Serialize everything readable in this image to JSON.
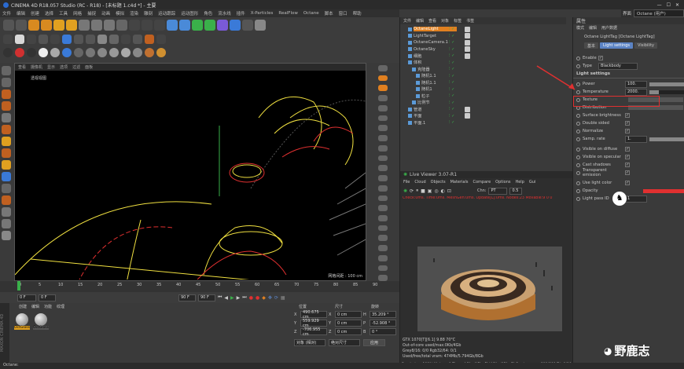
{
  "title_bar": {
    "text": "CINEMA 4D R18.057 Studio (RC - R18) - [未标题 1.c4d *] - 主要"
  },
  "menu": {
    "items": [
      "文件",
      "编辑",
      "创建",
      "选择",
      "工具",
      "网格",
      "捕捉",
      "动画",
      "模拟",
      "渲染",
      "雕刻",
      "运动跟踪",
      "运动图形",
      "角色",
      "流水线",
      "插件",
      "X-Particles",
      "RealFlow",
      "Octane",
      "脚本",
      "窗口",
      "帮助"
    ]
  },
  "layout": {
    "label": "界面",
    "value": "Octane (用户)"
  },
  "viewport": {
    "menu": [
      "查看",
      "摄像机",
      "显示",
      "选项",
      "过滤",
      "面板"
    ],
    "camera_label": "透视视图",
    "grid_text": "网格间距 : 100 cm"
  },
  "timeline": {
    "ticks": [
      "0",
      "5",
      "10",
      "15",
      "20",
      "25",
      "30",
      "35",
      "40",
      "45",
      "50",
      "55",
      "60",
      "65",
      "70",
      "75",
      "80",
      "85",
      "90"
    ],
    "current": "0 F",
    "start": "0 F",
    "end": "90 F",
    "end2": "90 F",
    "frame_badge": "0 F"
  },
  "materials": {
    "menu": [
      "创建",
      "编辑",
      "功能",
      "纹理"
    ],
    "items": [
      "OctGloss",
      "OctGloss"
    ]
  },
  "coords": {
    "headers": [
      "位置",
      "尺寸",
      "旋转"
    ],
    "rows": [
      [
        "X",
        "490.675 cm",
        "X",
        "0 cm",
        "H",
        "35.209 °"
      ],
      [
        "Y",
        "559.929 cm",
        "Y",
        "0 cm",
        "P",
        "-52.908 °"
      ],
      [
        "Z",
        "-706.955 cm",
        "Z",
        "0 cm",
        "B",
        "0 °"
      ]
    ],
    "mode1": "对象 (相对)",
    "mode2": "绝对尺寸",
    "apply": "应用"
  },
  "object_manager": {
    "menu": [
      "文件",
      "编辑",
      "查看",
      "对象",
      "标签",
      "书签"
    ],
    "objects": [
      {
        "name": "OctaneLight",
        "indent": 0,
        "selected": true
      },
      {
        "name": "LightTarget",
        "indent": 0,
        "selected": false
      },
      {
        "name": "OctaneCamera.1",
        "indent": 0,
        "selected": false
      },
      {
        "name": "OctaneSky",
        "indent": 0,
        "selected": false
      },
      {
        "name": "细胞",
        "indent": 0,
        "selected": false
      },
      {
        "name": "体积",
        "indent": 0,
        "selected": false
      },
      {
        "name": "克隆器",
        "indent": 1,
        "selected": false
      },
      {
        "name": "随机1.1",
        "indent": 2,
        "selected": false
      },
      {
        "name": "随机1.1",
        "indent": 2,
        "selected": false
      },
      {
        "name": "随机1",
        "indent": 2,
        "selected": false
      },
      {
        "name": "粒子",
        "indent": 2,
        "selected": false
      },
      {
        "name": "比例节",
        "indent": 1,
        "selected": false
      },
      {
        "name": "管道",
        "indent": 0,
        "selected": false
      },
      {
        "name": "平面",
        "indent": 0,
        "selected": false
      },
      {
        "name": "平面.1",
        "indent": 0,
        "selected": false
      }
    ]
  },
  "live_viewer": {
    "title": "Live Viewer 3.07-R1",
    "menu": [
      "File",
      "Cloud",
      "Objects",
      "Materials",
      "Compare",
      "Options",
      "Help",
      "Gui"
    ],
    "channel_label": "Chn:",
    "channel_value": "PT",
    "zoom": "0.5",
    "status_line": "Check:0ms. Time:0ms. MeshGen:0ms. Update[L]:0ms. Nodes:23 Movable:9  0 0",
    "stats": [
      "GTX 1070[T][6.1]   9.88   70°C",
      "Out-of-core used/max:0Kb/4Gb",
      "Grey8/16: 0/0          Rgb32/64: 0/1",
      "Used/free/total vram: 474Mb/5.794Gb/8Gb"
    ],
    "render_line": "Rendering: 100%   Ms/sec: 0   Time: 小时 : 分钟 : 秒/小时 : 分钟 : 秒   Spp/maxspp: 800/800   Tri: 0/196k   Mesh: 1/32"
  },
  "attributes": {
    "top_label": "属性",
    "menu": [
      "模式",
      "编辑",
      "用户数据"
    ],
    "object_title": "Octane LightTag [Octane LightTag]",
    "tabs": [
      "基本",
      "Light settings",
      "Visibility"
    ],
    "enable_label": "Enable",
    "type_label": "Type",
    "type_value": "Blackbody",
    "section": "Light settings",
    "rows": [
      {
        "label": "Power",
        "value": "100."
      },
      {
        "label": "Temperature",
        "value": "2000."
      },
      {
        "label": "Texture",
        "value": ""
      },
      {
        "label": "Distribution",
        "value": ""
      },
      {
        "label": "Surface brightness",
        "value": ""
      },
      {
        "label": "Double sided",
        "value": ""
      },
      {
        "label": "Normalize",
        "value": ""
      },
      {
        "label": "Samp. rate",
        "value": "1."
      },
      {
        "label": "Visible on diffuse",
        "value": ""
      },
      {
        "label": "Visible on specular",
        "value": ""
      },
      {
        "label": "Cast shadows",
        "value": ""
      },
      {
        "label": "Transparent emission",
        "value": ""
      },
      {
        "label": "Use light color",
        "value": ""
      },
      {
        "label": "Opacity",
        "value": ""
      },
      {
        "label": "Light pass ID",
        "value": "1"
      }
    ]
  },
  "status_bar": {
    "text": "Octane:"
  },
  "watermark": {
    "text": "野鹿志"
  },
  "colors": {
    "accent_red": "#e03030",
    "selection_blue": "#5b83c4",
    "orange": "#e08020",
    "light_yellow": "#f0e040"
  }
}
